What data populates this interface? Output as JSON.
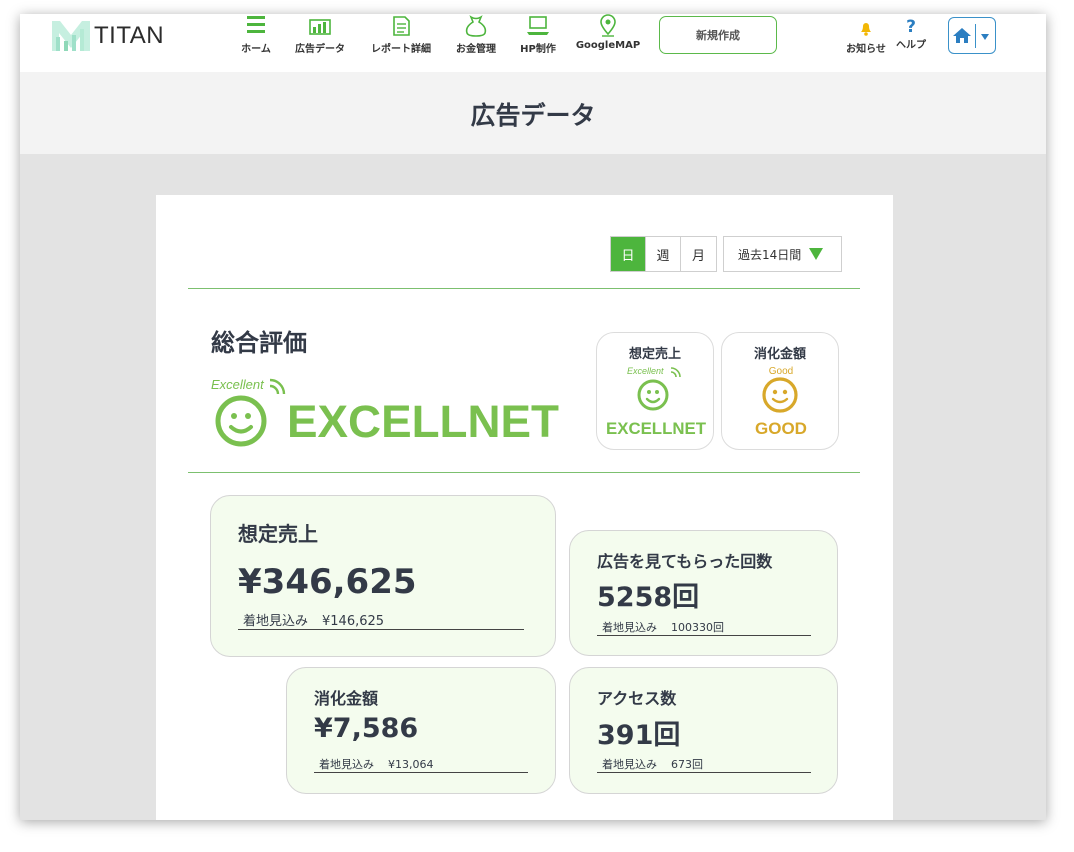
{
  "app": {
    "logo_text": "TITAN"
  },
  "nav": {
    "items": [
      {
        "label": "ホーム",
        "icon": "menu-icon"
      },
      {
        "label": "広告データ",
        "icon": "bar-chart-icon"
      },
      {
        "label": "レポート詳細",
        "icon": "document-icon"
      },
      {
        "label": "お金管理",
        "icon": "money-bag-icon"
      },
      {
        "label": "HP制作",
        "icon": "laptop-icon"
      },
      {
        "label": "GoogleMAP",
        "icon": "map-pin-icon"
      }
    ],
    "new_button": "新規作成",
    "notice_label": "お知らせ",
    "help_label": "ヘルプ",
    "help_glyph": "?"
  },
  "page": {
    "title": "広告データ"
  },
  "filters": {
    "tabs": [
      "日",
      "週",
      "月"
    ],
    "active_tab": "日",
    "period": "過去14日間"
  },
  "overall": {
    "title": "総合評価",
    "rating_small": "Excellent",
    "rating": "EXCELLNET"
  },
  "mini_ratings": [
    {
      "title": "想定売上",
      "small": "Excellent",
      "rating": "EXCELLNET",
      "color": "#7ac04f"
    },
    {
      "title": "消化金額",
      "small": "Good",
      "rating": "GOOD",
      "color": "#d8a82a"
    }
  ],
  "stats": {
    "sales": {
      "title": "想定売上",
      "value": "¥346,625",
      "sub_label": "着地見込み",
      "sub_value": "¥146,625"
    },
    "views": {
      "title": "広告を見てもらった回数",
      "value": "5258回",
      "sub_label": "着地見込み",
      "sub_value": "100330回"
    },
    "spend": {
      "title": "消化金額",
      "value": "¥7,586",
      "sub_label": "着地見込み",
      "sub_value": "¥13,064"
    },
    "access": {
      "title": "アクセス数",
      "value": "391回",
      "sub_label": "着地見込み",
      "sub_value": "673回"
    }
  },
  "colors": {
    "accent_green": "#4db53d",
    "excellent_green": "#7ac04f",
    "good_gold": "#d8a82a",
    "home_blue": "#3a91c9",
    "bell_gold": "#f2b705"
  }
}
